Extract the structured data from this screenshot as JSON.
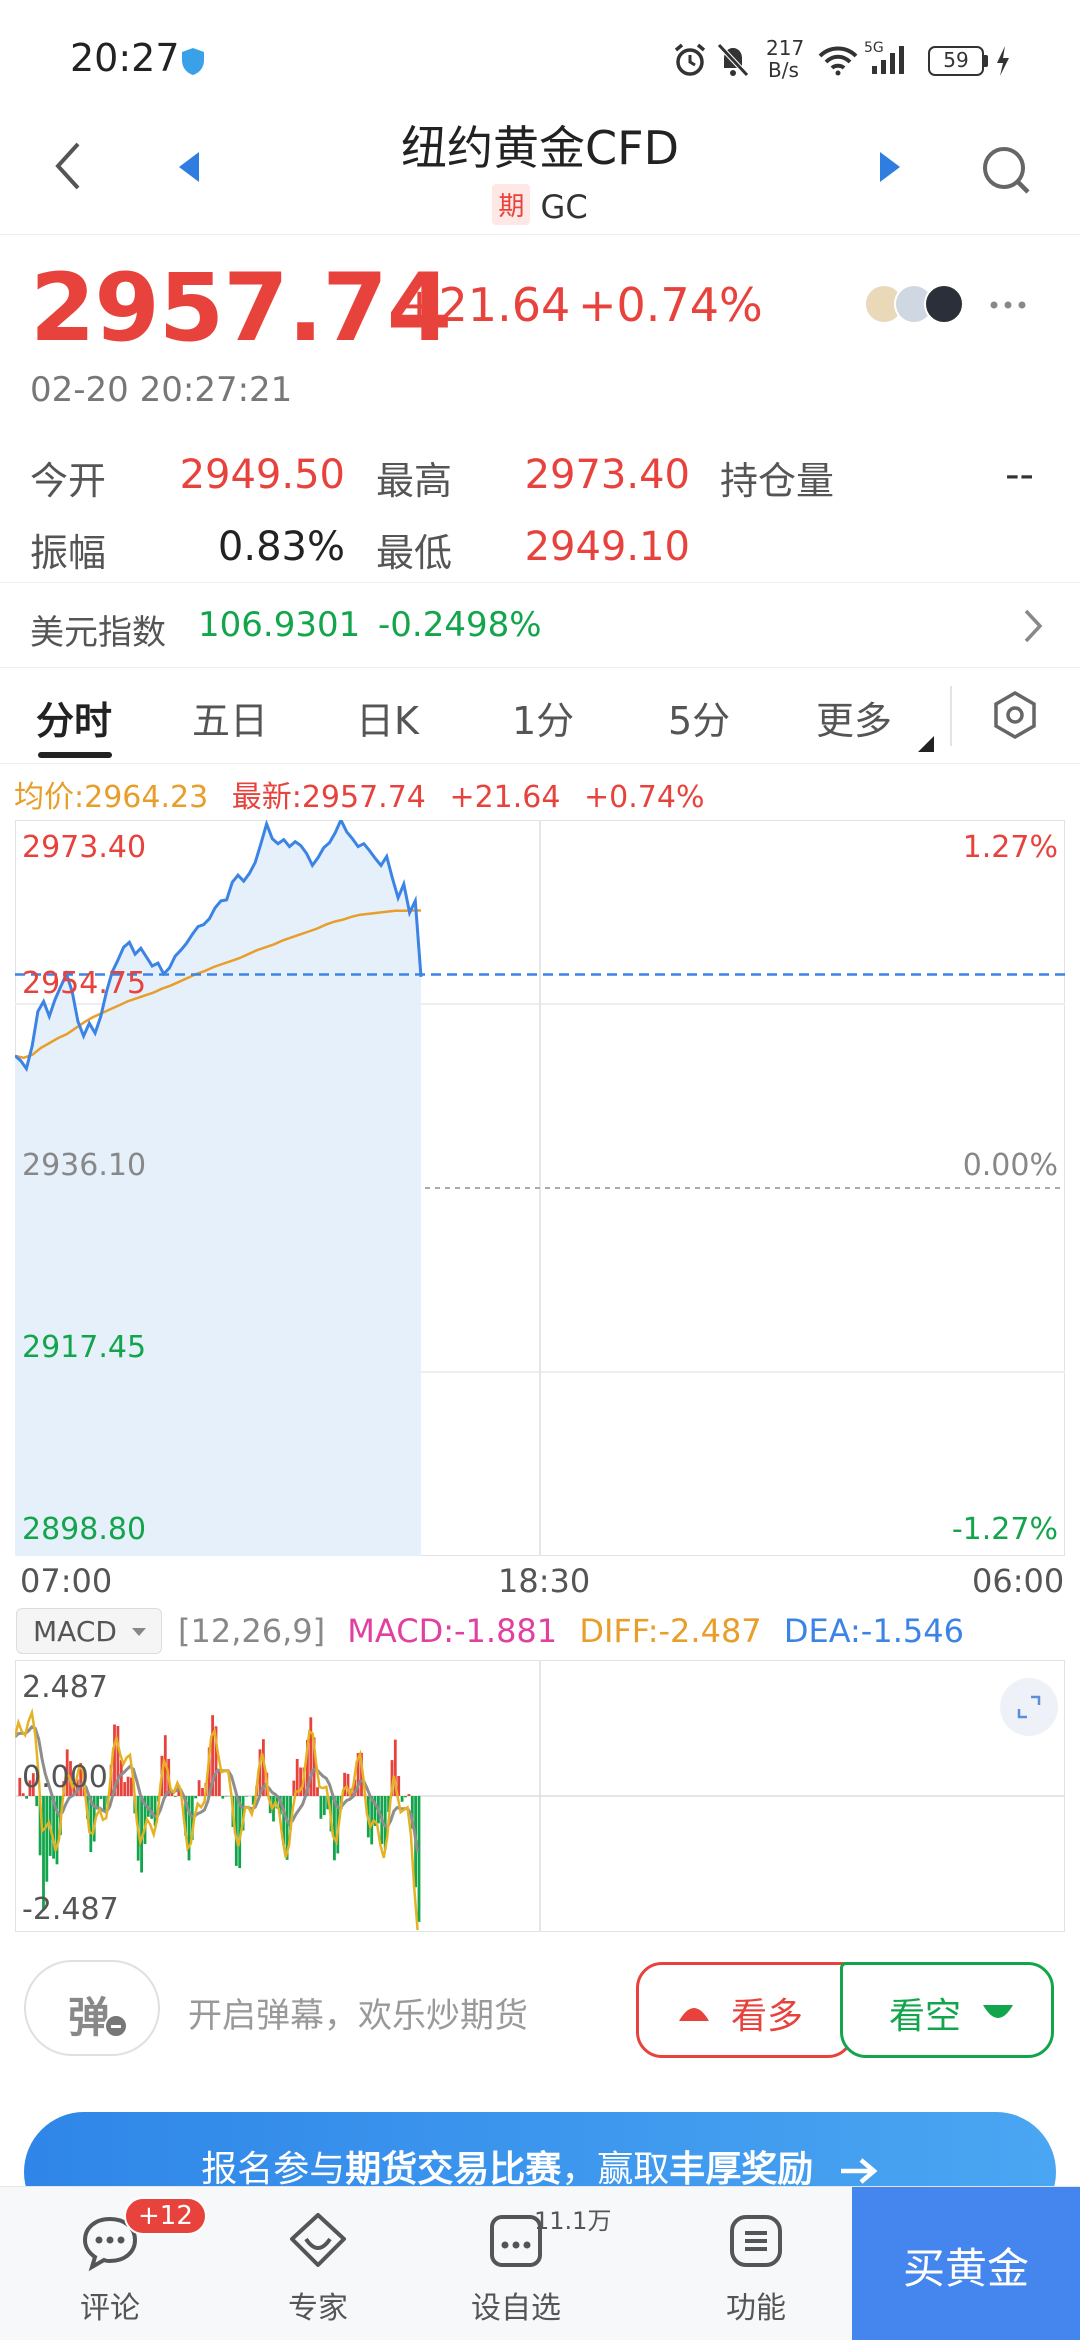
{
  "colors": {
    "up": "#e8423c",
    "down": "#13a54c",
    "accent": "#3b84e6",
    "avg": "#e79e2a"
  },
  "status_bar": {
    "time": "20:27",
    "speed_top": "217",
    "speed_bottom": "B/s",
    "network": "5G",
    "battery": "59"
  },
  "header": {
    "title": "纽约黄金CFD",
    "tag": "期",
    "code": "GC"
  },
  "quote": {
    "price": "2957.74",
    "change": "+21.64",
    "pct": "+0.74%",
    "datetime": "02-20 20:27:21"
  },
  "stats": [
    {
      "label": "今开",
      "value": "2949.50",
      "color": "up"
    },
    {
      "label": "最高",
      "value": "2973.40",
      "color": "up"
    },
    {
      "label": "持仓量",
      "value": "--",
      "color": "neutral"
    },
    {
      "label": "振幅",
      "value": "0.83%",
      "color": "neutral"
    },
    {
      "label": "最低",
      "value": "2949.10",
      "color": "up"
    }
  ],
  "dxy": {
    "label": "美元指数",
    "value": "106.9301",
    "change": "-0.2498%"
  },
  "tabs": [
    "分时",
    "五日",
    "日K",
    "1分",
    "5分",
    "更多"
  ],
  "info_line": {
    "avg": "均价:2964.23",
    "latest": "最新:2957.74",
    "change": "+21.64",
    "pct": "+0.74%"
  },
  "price_axis": {
    "high": "2973.40",
    "mid_up": "2954.75",
    "base": "2936.10",
    "mid_down": "2917.45",
    "low": "2898.80"
  },
  "pct_axis": {
    "high": "1.27%",
    "base": "0.00%",
    "low": "-1.27%"
  },
  "time_axis": [
    "07:00",
    "18:30",
    "06:00"
  ],
  "macd_bar": {
    "selector": "MACD",
    "params": "[12,26,9]",
    "macd": "MACD:-1.881",
    "diff": "DIFF:-2.487",
    "dea": "DEA:-1.546"
  },
  "macd_axis": {
    "top": "2.487",
    "zero": "0.000",
    "bottom": "-2.487"
  },
  "chart_data": {
    "type": "line",
    "ylim": [
      2898.8,
      2973.4
    ],
    "base": 2936.1,
    "current": 2957.74,
    "price": [
      2949.5,
      2949.0,
      2948.2,
      2950.5,
      2954.0,
      2955.0,
      2953.5,
      2955.2,
      2956.5,
      2957.8,
      2956.0,
      2953.0,
      2951.5,
      2952.8,
      2951.8,
      2953.5,
      2956.0,
      2958.0,
      2959.2,
      2960.5,
      2961.0,
      2959.8,
      2960.4,
      2959.5,
      2958.6,
      2958.9,
      2957.8,
      2958.4,
      2959.6,
      2960.2,
      2960.9,
      2961.8,
      2962.6,
      2962.8,
      2963.4,
      2964.5,
      2965.2,
      2965.3,
      2967.1,
      2967.8,
      2967.2,
      2968.0,
      2969.1,
      2971.0,
      2973.0,
      2971.5,
      2971.0,
      2971.4,
      2970.7,
      2971.2,
      2970.8,
      2970.0,
      2968.8,
      2969.6,
      2970.6,
      2971.1,
      2972.1,
      2973.4,
      2972.2,
      2971.5,
      2970.7,
      2971.0,
      2970.3,
      2969.5,
      2968.8,
      2969.7,
      2967.5,
      2965.5,
      2966.9,
      2964.0,
      2965.2,
      2957.5
    ],
    "avg": [
      2949.5,
      2949.3,
      2949.6,
      2950.3,
      2950.8,
      2951.3,
      2951.7,
      2952.3,
      2952.9,
      2953.4,
      2953.8,
      2954.2,
      2954.6,
      2955.0,
      2955.3,
      2955.6,
      2955.9,
      2956.3,
      2956.6,
      2957.0,
      2957.4,
      2957.8,
      2958.1,
      2958.5,
      2958.8,
      2959.1,
      2959.4,
      2959.8,
      2960.2,
      2960.5,
      2960.8,
      2961.2,
      2961.5,
      2961.8,
      2962.1,
      2962.4,
      2962.8,
      2963.1,
      2963.3,
      2963.6,
      2963.8,
      2963.9,
      2964.0,
      2964.1,
      2964.2,
      2964.2,
      2964.23,
      2964.23
    ]
  },
  "bottom_actions": {
    "danmu_icon": "弹",
    "danmu_text": "开启弹幕，欢乐炒期货",
    "bull": "看多",
    "bear": "看空"
  },
  "banner": {
    "pre": "报名参与",
    "b1": "期货交易比赛",
    "mid": "，赢取",
    "b2": "丰厚奖励"
  },
  "bottom_nav": {
    "items": [
      {
        "label": "评论",
        "badge": "+12"
      },
      {
        "label": "专家"
      },
      {
        "label": "设自选",
        "badge": "11.1万"
      },
      {
        "label": "功能"
      }
    ],
    "buy": "买黄金"
  }
}
